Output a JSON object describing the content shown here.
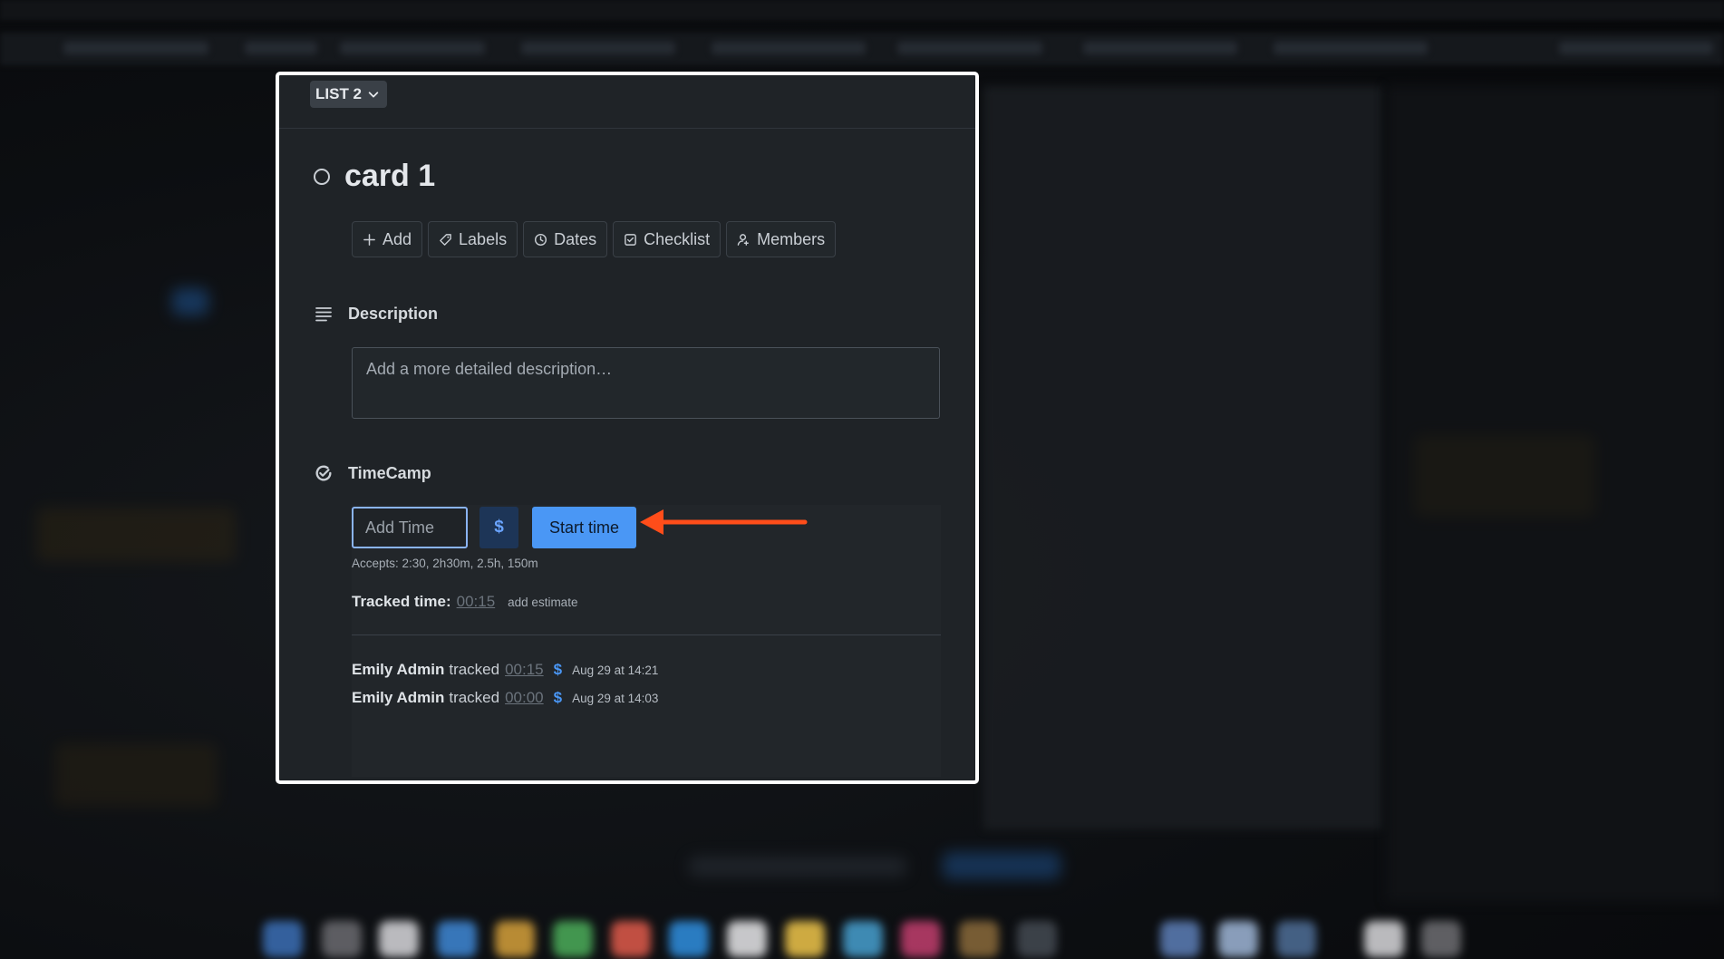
{
  "modal": {
    "list_chip": "LIST 2",
    "card_title": "card 1",
    "actions": [
      {
        "label": "Add",
        "icon": "plus-icon"
      },
      {
        "label": "Labels",
        "icon": "tag-icon"
      },
      {
        "label": "Dates",
        "icon": "clock-icon"
      },
      {
        "label": "Checklist",
        "icon": "checkbox-icon"
      },
      {
        "label": "Members",
        "icon": "user-icon"
      }
    ],
    "description": {
      "heading": "Description",
      "placeholder": "Add a more detailed description…"
    },
    "timecamp": {
      "heading": "TimeCamp",
      "add_time_placeholder": "Add Time",
      "billable_symbol": "$",
      "start_label": "Start time",
      "accepts": "Accepts: 2:30, 2h30m, 2.5h, 150m",
      "tracked_label": "Tracked time:",
      "tracked_value": "00:15",
      "add_estimate": "add estimate",
      "entries": [
        {
          "user": "Emily Admin",
          "verb": "tracked",
          "time": "00:15",
          "symbol": "$",
          "date": "Aug 29 at 14:21"
        },
        {
          "user": "Emily Admin",
          "verb": "tracked",
          "time": "00:00",
          "symbol": "$",
          "date": "Aug 29 at 14:03"
        }
      ]
    }
  },
  "colors": {
    "accent": "#4a97f5",
    "annotation_arrow": "#ff4d1a",
    "modal_bg": "#1f2327"
  }
}
